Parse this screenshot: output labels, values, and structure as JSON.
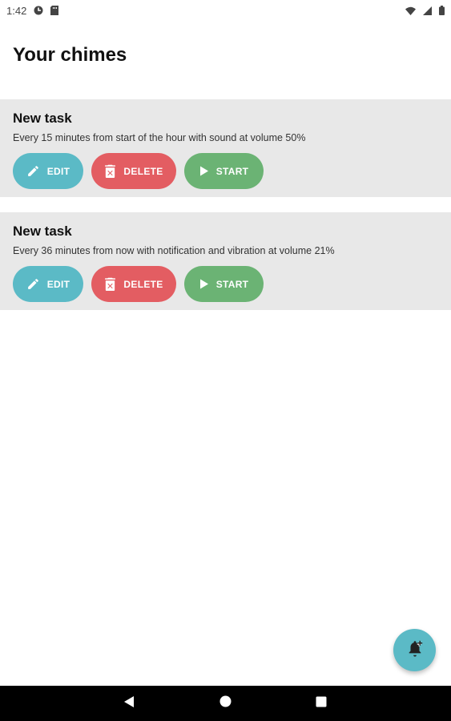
{
  "status_bar": {
    "time": "1:42",
    "icons_left": [
      "notification-app-icon",
      "sd-card-icon"
    ],
    "icons_right": [
      "wifi-icon",
      "signal-icon",
      "battery-icon"
    ]
  },
  "page": {
    "title": "Your chimes"
  },
  "tasks": [
    {
      "title": "New task",
      "description": "Every 15 minutes from start of the hour with sound at volume 50%",
      "edit_label": "EDIT",
      "delete_label": "DELETE",
      "start_label": "START"
    },
    {
      "title": "New task",
      "description": "Every 36 minutes from now with notification and vibration at volume 21%",
      "edit_label": "EDIT",
      "delete_label": "DELETE",
      "start_label": "START"
    }
  ],
  "fab": {
    "icon": "add-alarm-bell-icon"
  },
  "nav_bar": {
    "buttons": [
      "back-icon",
      "home-icon",
      "recents-icon"
    ]
  },
  "colors": {
    "edit": "#5bbac6",
    "delete": "#e35d62",
    "start": "#6bb374",
    "card_bg": "#e8e8e8",
    "fab": "#5bbac6"
  }
}
